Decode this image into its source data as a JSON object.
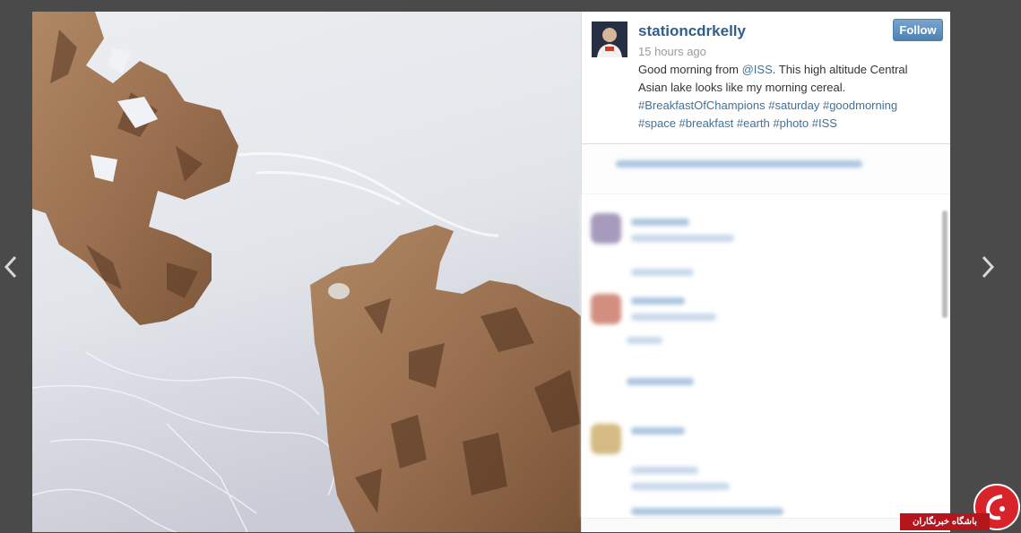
{
  "nav": {
    "prev_icon": "chevron-left-icon",
    "next_icon": "chevron-right-icon"
  },
  "post": {
    "username": "stationcdrkelly",
    "time": "15 hours ago",
    "follow_label": "Follow",
    "caption_prefix": "Good morning from ",
    "caption_mention": "@ISS",
    "caption_text": ". This high altitude Central Asian lake looks like my morning cereal.",
    "hashtags": [
      "#BreakfastOfChampions",
      "#saturday",
      "#goodmorning",
      "#space",
      "#breakfast",
      "#earth",
      "#photo",
      "#ISS"
    ]
  },
  "watermark": {
    "text": "باشگاه خبرنگاران"
  },
  "colors": {
    "username": "#2f5f8c",
    "link": "#3f729b",
    "follow_bg": "#5b8ebf",
    "backdrop": "#4a4a4a",
    "watermark_red": "#d8232a"
  }
}
